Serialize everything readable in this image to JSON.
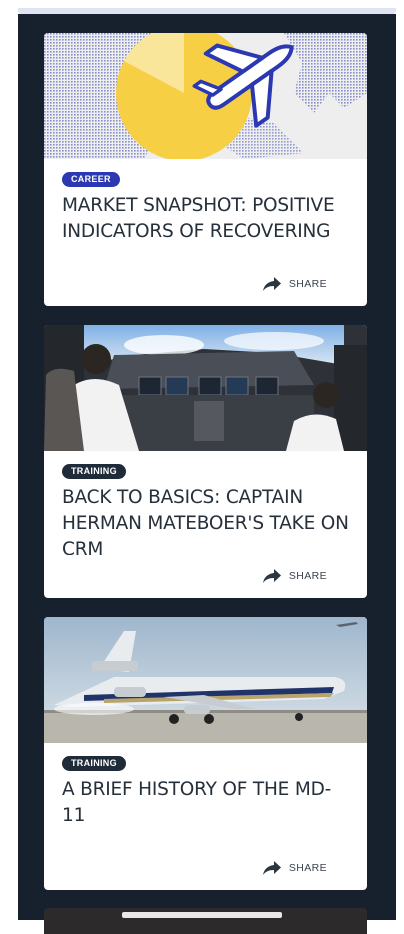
{
  "feed": {
    "share_label": "SHARE",
    "cards": [
      {
        "tag": "CAREER",
        "title": "MARKET SNAPSHOT: POSITIVE INDICATORS OF RECOVERING",
        "tag_color": "#2b38b2",
        "image": "map-airplane-illustration"
      },
      {
        "tag": "TRAINING",
        "title": "BACK TO BASICS: CAPTAIN HERMAN MATEBOER'S TAKE ON CRM",
        "tag_color": "#202b3a",
        "image": "cockpit-pilots-photo"
      },
      {
        "tag": "TRAINING",
        "title": "A BRIEF HISTORY OF THE MD-11",
        "tag_color": "#202b3a",
        "image": "md11-aircraft-photo"
      }
    ]
  },
  "colors": {
    "background": "#17212d",
    "card": "#ffffff",
    "accent_yellow": "#f7cf45",
    "plane_blue": "#2b38b2"
  }
}
